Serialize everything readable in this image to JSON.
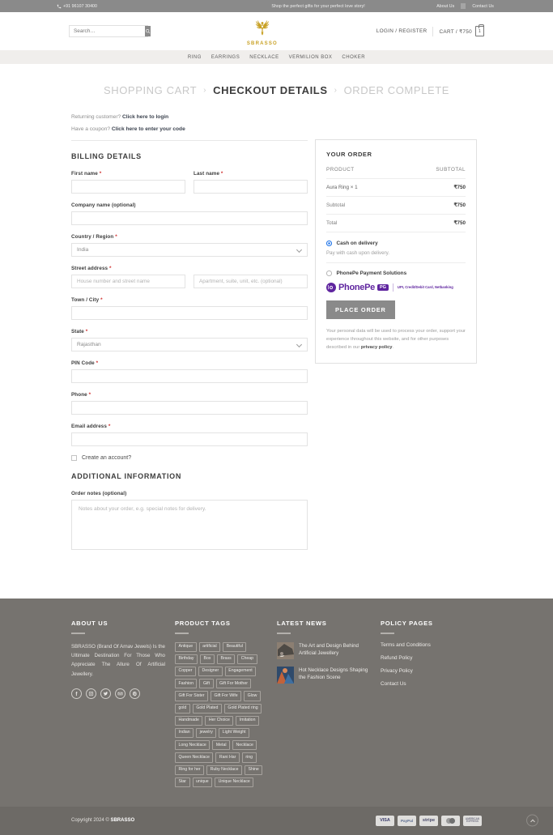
{
  "topbar": {
    "phone": "+91 96107 30400",
    "promo": "Shop the perfect gifts for your perfect love story!",
    "about": "About Us",
    "contact": "Contact Us"
  },
  "header": {
    "search_placeholder": "Search…",
    "logo_word": "SBRASSO",
    "login": "LOGIN / REGISTER",
    "cart_label": "CART / ₹750",
    "cart_count": "1"
  },
  "nav": {
    "items": [
      "RING",
      "EARRINGS",
      "NECKLACE",
      "VERMILION BOX",
      "CHOKER"
    ]
  },
  "steps": {
    "cart": "SHOPPING CART",
    "sep": "›",
    "checkout": "CHECKOUT DETAILS",
    "complete": "ORDER COMPLETE"
  },
  "notices": {
    "returning_prefix": "Returning customer? ",
    "returning_link": "Click here to login",
    "coupon_prefix": "Have a coupon? ",
    "coupon_link": "Click here to enter your code"
  },
  "billing": {
    "title": "BILLING DETAILS",
    "first_name": {
      "label": "First name",
      "required": "*",
      "value": ""
    },
    "last_name": {
      "label": "Last name",
      "required": "*",
      "value": ""
    },
    "company": {
      "label": "Company name (optional)",
      "value": ""
    },
    "country": {
      "label": "Country / Region",
      "required": "*",
      "value": "India",
      "options": [
        "India"
      ]
    },
    "street": {
      "label": "Street address",
      "required": "*",
      "placeholder1": "House number and street name",
      "placeholder2": "Apartment, suite, unit, etc. (optional)"
    },
    "city": {
      "label": "Town / City",
      "required": "*",
      "value": ""
    },
    "state": {
      "label": "State",
      "required": "*",
      "value": "Rajasthan",
      "options": [
        "Rajasthan"
      ]
    },
    "pin": {
      "label": "PIN Code",
      "required": "*",
      "value": ""
    },
    "phone": {
      "label": "Phone",
      "required": "*",
      "value": ""
    },
    "email": {
      "label": "Email address",
      "required": "*",
      "value": ""
    },
    "create_account": "Create an account?"
  },
  "additional": {
    "title": "ADDITIONAL INFORMATION",
    "notes_label": "Order notes (optional)",
    "notes_placeholder": "Notes about your order, e.g. special notes for delivery."
  },
  "order": {
    "title": "YOUR ORDER",
    "col_product": "PRODUCT",
    "col_subtotal": "SUBTOTAL",
    "lines": [
      {
        "label": "Aura Ring  × 1",
        "amount": "₹750"
      }
    ],
    "subtotal": {
      "label": "Subtotal",
      "amount": "₹750"
    },
    "total": {
      "label": "Total",
      "amount": "₹750"
    },
    "payment": {
      "cod_label": "Cash on delivery",
      "cod_selected": true,
      "cod_desc": "Pay with cash upon delivery.",
      "phonepe_label": "PhonePe Payment Solutions",
      "phonepe_selected": false,
      "phonepe_word": "PhonePe",
      "phonepe_tag": "PG",
      "phonepe_sub": "UPI, Credit/Debit Card, Netbanking"
    },
    "place_order": "PLACE ORDER",
    "privacy_text": "Your personal data will be used to process your order, support your experience throughout this website, and for other purposes described in our ",
    "privacy_link": "privacy policy",
    "privacy_end": "."
  },
  "footer": {
    "about": {
      "title": "ABOUT US",
      "text": "SBRASSO (Brand Of Arnav Jewels) Is the Ultimate Destination For Those Who Appreciate The Allure Of Artificial Jewellery.",
      "socials": [
        "facebook-icon",
        "instagram-icon",
        "twitter-icon",
        "email-icon",
        "pinterest-icon"
      ]
    },
    "tags": {
      "title": "PRODUCT TAGS",
      "items": [
        "Antique",
        "artificial",
        "Beautiful",
        "Birthday",
        "Box",
        "Brass",
        "Cheap",
        "Copper",
        "Designer",
        "Engagement",
        "Fashion",
        "Gift",
        "Gift For Mother",
        "Gift For Sister",
        "Gift For Wife",
        "Glow",
        "gold",
        "Gold Plated",
        "Gold Plated ring",
        "Handmade",
        "Her Choice",
        "Imitation",
        "Indian",
        "jewelry",
        "Light Weight",
        "Long Necklace",
        "Metal",
        "Necklace",
        "Queen Necklace",
        "Rani Har",
        "ring",
        "Ring for her",
        "Ruby Necklace",
        "Shine",
        "Star",
        "unique",
        "Unique Necklace"
      ]
    },
    "news": {
      "title": "LATEST NEWS",
      "items": [
        {
          "title": "The Art and Design Behind Artificial Jewellery"
        },
        {
          "title": "Hot Necklace Designs Shaping the Fashion Scene"
        }
      ]
    },
    "policy": {
      "title": "POLICY PAGES",
      "items": [
        "Terms and Conditions",
        "Refund Policy",
        "Privacy Policy",
        "Contact Us"
      ]
    }
  },
  "bottom": {
    "copyright_prefix": "Copyright 2024 © ",
    "copyright_brand": "SBRASSO",
    "badges": [
      "VISA",
      "PayPal",
      "stripe",
      "mastercard",
      "AMERICAN EXPRESS"
    ]
  }
}
